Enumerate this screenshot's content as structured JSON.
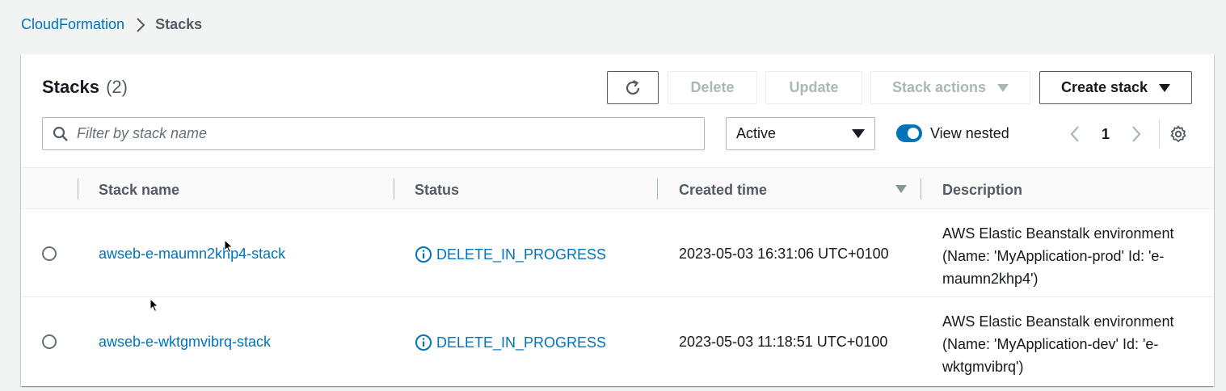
{
  "breadcrumb": {
    "parent": "CloudFormation",
    "current": "Stacks"
  },
  "panel": {
    "title": "Stacks",
    "count": "(2)"
  },
  "toolbar": {
    "delete_label": "Delete",
    "update_label": "Update",
    "stack_actions_label": "Stack actions",
    "create_stack_label": "Create stack"
  },
  "filter": {
    "placeholder": "Filter by stack name",
    "value": ""
  },
  "status_filter": {
    "selected": "Active"
  },
  "view_nested": {
    "label": "View nested",
    "enabled": true
  },
  "pagination": {
    "current_page": "1"
  },
  "table": {
    "columns": [
      "Stack name",
      "Status",
      "Created time",
      "Description"
    ],
    "sort": {
      "column": "Created time",
      "direction": "descending"
    },
    "rows": [
      {
        "stack_name": "awseb-e-maumn2khp4-stack",
        "status": "DELETE_IN_PROGRESS",
        "created_time": "2023-05-03 16:31:06 UTC+0100",
        "description_lines": [
          "AWS Elastic Beanstalk environment",
          "(Name: 'MyApplication-prod' Id: 'e-",
          "maumn2khp4')"
        ]
      },
      {
        "stack_name": "awseb-e-wktgmvibrq-stack",
        "status": "DELETE_IN_PROGRESS",
        "created_time": "2023-05-03 11:18:51 UTC+0100",
        "description_lines": [
          "AWS Elastic Beanstalk environment",
          "(Name: 'MyApplication-dev' Id: 'e-",
          "wktgmvibrq')"
        ]
      }
    ]
  },
  "colors": {
    "link": "#0073bb",
    "toggle_on": "#0073bb",
    "disabled_text": "#aab7b8",
    "background": "#f2f3f3"
  },
  "icons": {
    "refresh": "refresh-icon",
    "search": "search-icon",
    "status": "info-icon",
    "settings": "gear-icon"
  }
}
